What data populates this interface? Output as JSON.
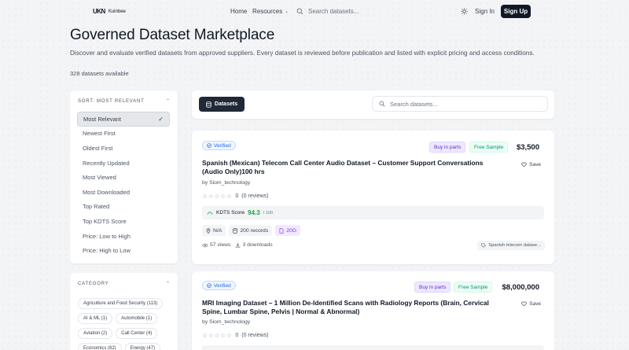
{
  "header": {
    "logo_mark": "UKN",
    "logo_text": "Kuinbee",
    "nav": {
      "home": "Home",
      "resources": "Resources"
    },
    "search_placeholder": "Search datasets...",
    "sign_in": "Sign In",
    "sign_up": "Sign Up"
  },
  "page": {
    "title": "Governed Dataset Marketplace",
    "description": "Discover and evaluate verified datasets from approved suppliers. Every dataset is reviewed before publication and listed with explicit pricing and access conditions.",
    "count": "328 datasets available"
  },
  "sort": {
    "title": "SORT: MOST RELEVANT",
    "options": [
      "Most Relevant",
      "Newest First",
      "Oldest First",
      "Recently Updated",
      "Most Viewed",
      "Most Downloaded",
      "Top Rated",
      "Top KDTS Score",
      "Price: Low to High",
      "Price: High to Low"
    ],
    "selected": "Most Relevant"
  },
  "category": {
    "title": "CATEGORY",
    "chips": [
      "Agriculture and Food Security (113)",
      "AI & ML (1)",
      "Automobile (1)",
      "Aviation (2)",
      "Call Center (4)",
      "Economics (62)",
      "Energy (47)"
    ]
  },
  "toolbar": {
    "tab_label": "Datasets",
    "search_placeholder": "Search datasets..."
  },
  "cards": [
    {
      "verified": "Verified",
      "buy_label": "Buy in parts",
      "sample_label": "Free Sample",
      "price": "$3,500",
      "title": "Spanish (Mexican) Telecom Call Center Audio Dataset – Customer Support Conversations (Audio Only)100 hrs",
      "save": "Save",
      "by": "by Siom_technology",
      "rating": "0",
      "reviews": "(0 reviews)",
      "kdts_label": "KDTS Score",
      "kdts_score": "94.3",
      "kdts_max": "/ 100",
      "location": "N/A",
      "records": "200 records",
      "size": "20G",
      "views": "57 views",
      "downloads": "3 downloads",
      "tag": "Spanish telecom datase..."
    },
    {
      "verified": "Verified",
      "buy_label": "Buy in parts",
      "sample_label": "Free Sample",
      "price": "$8,000,000",
      "title": "MRI Imaging Dataset – 1 Million De-Identified Scans with Radiology Reports (Brain, Cervical Spine, Lumbar Spine, Pelvis | Normal & Abnormal)",
      "save": "Save",
      "by": "by Siom_technology",
      "rating": "0",
      "reviews": "(0 reviews)"
    }
  ],
  "colors": {
    "primary_dark": "#111827",
    "verified_blue": "#2563eb",
    "score_green": "#16a34a",
    "purple": "#7c3aed"
  }
}
